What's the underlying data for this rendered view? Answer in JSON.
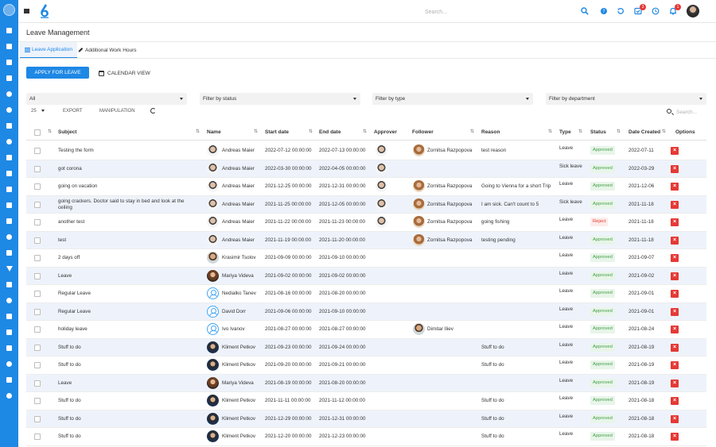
{
  "topbar": {
    "search_placeholder": "Search...",
    "tasks_badge": "3",
    "notifications_badge": "1"
  },
  "page": {
    "title": "Leave Management"
  },
  "tabs": [
    {
      "label": "Leave Application",
      "active": true
    },
    {
      "label": "Additional Work Hours",
      "active": false
    }
  ],
  "actions": {
    "apply_label": "APPLY FOR LEAVE",
    "calendar_label": "CALENDAR VIEW"
  },
  "filters": {
    "employee": "All",
    "status": "Filter by status",
    "type": "Filter by type",
    "department": "Filter by department"
  },
  "controls": {
    "page_size": "25",
    "export_label": "EXPORT",
    "manipulation_label": "MANIPULATION",
    "search_placeholder": "Search..."
  },
  "columns": {
    "subject": "Subject",
    "name": "Name",
    "start": "Start date",
    "end": "End date",
    "approver": "Approver",
    "follower": "Follower",
    "reason": "Reason",
    "type": "Type",
    "status": "Status",
    "created": "Date Created",
    "options": "Options"
  },
  "rows": [
    {
      "subject": "Testing the form",
      "name": "Andreas Maier",
      "avatar": "m1",
      "start": "2022-07-12 00:00:00",
      "end": "2022-07-13 00:00:00",
      "approver": true,
      "follower": "Zornitsa Razpopova",
      "follower_avatar": "f1",
      "reason": "test reason",
      "type": "Leave",
      "status": "Approved",
      "created": "2022-07-11"
    },
    {
      "subject": "got corona",
      "name": "Andreas Maier",
      "avatar": "m1",
      "start": "2022-03-30 00:00:00",
      "end": "2022-04-05 00:00:00",
      "approver": true,
      "follower": "",
      "follower_avatar": "",
      "reason": "",
      "type": "Sick leave",
      "status": "Approved",
      "created": "2022-03-29"
    },
    {
      "subject": "going on vacation",
      "name": "Andreas Maier",
      "avatar": "m1",
      "start": "2021-12-25 00:00:00",
      "end": "2021-12-31 00:00:00",
      "approver": true,
      "follower": "Zornitsa Razpopova",
      "follower_avatar": "f1",
      "reason": "Going to Vienna for a short Trip",
      "type": "Leave",
      "status": "Approved",
      "created": "2021-12-06"
    },
    {
      "subject": "going crackers. Doctor said to stay in bed and look at the ceiling",
      "name": "Andreas Maier",
      "avatar": "m1",
      "start": "2021-11-25 00:00:00",
      "end": "2021-12-05 00:00:00",
      "approver": true,
      "follower": "Zornitsa Razpopova",
      "follower_avatar": "f1",
      "reason": "I am sick. Can't count to 5",
      "type": "Sick leave",
      "status": "Approved",
      "created": "2021-11-18"
    },
    {
      "subject": "another test",
      "name": "Andreas Maier",
      "avatar": "m1",
      "start": "2021-11-22 00:00:00",
      "end": "2021-11-23 00:00:00",
      "approver": true,
      "follower": "Zornitsa Razpopova",
      "follower_avatar": "f1",
      "reason": "going fishing",
      "type": "Leave",
      "status": "Reject",
      "created": "2021-11-18"
    },
    {
      "subject": "test",
      "name": "Andreas Maier",
      "avatar": "m1",
      "start": "2021-11-19 00:00:00",
      "end": "2021-11-20 00:00:00",
      "approver": false,
      "follower": "Zornitsa Razpopova",
      "follower_avatar": "f1",
      "reason": "testing pending",
      "type": "Leave",
      "status": "Approved",
      "created": "2021-11-18"
    },
    {
      "subject": "2 days off",
      "name": "Krasimir Tsolov",
      "avatar": "m2",
      "start": "2021-09-09 00:00:00",
      "end": "2021-09-10 00:00:00",
      "approver": false,
      "follower": "",
      "follower_avatar": "",
      "reason": "",
      "type": "Leave",
      "status": "Approved",
      "created": "2021-09-07"
    },
    {
      "subject": "Leave",
      "name": "Mariya Videva",
      "avatar": "f2",
      "start": "2021-09-02 00:00:00",
      "end": "2021-09-02 00:00:00",
      "approver": false,
      "follower": "",
      "follower_avatar": "",
      "reason": "",
      "type": "Leave",
      "status": "Approved",
      "created": "2021-09-02"
    },
    {
      "subject": "Regular Leave",
      "name": "Nedialko Tanev",
      "avatar": "u1",
      "start": "2021-08-16 00:00:00",
      "end": "2021-08-20 00:00:00",
      "approver": false,
      "follower": "",
      "follower_avatar": "",
      "reason": "",
      "type": "Leave",
      "status": "Approved",
      "created": "2021-09-01"
    },
    {
      "subject": "Regular Leave",
      "name": "David Dorr",
      "avatar": "u1",
      "start": "2021-09-06 00:00:00",
      "end": "2021-09-10 00:00:00",
      "approver": false,
      "follower": "",
      "follower_avatar": "",
      "reason": "",
      "type": "Leave",
      "status": "Approved",
      "created": "2021-09-01"
    },
    {
      "subject": "holiday leave",
      "name": "Ivo Ivanov",
      "avatar": "u1",
      "start": "2021-08-27 00:00:00",
      "end": "2021-08-27 00:00:00",
      "approver": false,
      "follower": "Dimitar Iliev",
      "follower_avatar": "m2",
      "reason": "",
      "type": "Leave",
      "status": "Approved",
      "created": "2021-08-24"
    },
    {
      "subject": "Stuff to do",
      "name": "Kliment Petkov",
      "avatar": "m3",
      "start": "2021-09-23 00:00:00",
      "end": "2021-09-24 00:00:00",
      "approver": false,
      "follower": "",
      "follower_avatar": "",
      "reason": "Stuff to do",
      "type": "Leave",
      "status": "Approved",
      "created": "2021-08-19"
    },
    {
      "subject": "Stuff to do",
      "name": "Kliment Petkov",
      "avatar": "m3",
      "start": "2021-09-20 00:00:00",
      "end": "2021-09-21 00:00:00",
      "approver": false,
      "follower": "",
      "follower_avatar": "",
      "reason": "Stuff to do",
      "type": "Leave",
      "status": "Approved",
      "created": "2021-08-19"
    },
    {
      "subject": "Leave",
      "name": "Mariya Videva",
      "avatar": "f2",
      "start": "2021-08-19 00:00:00",
      "end": "2021-08-20 00:00:00",
      "approver": false,
      "follower": "",
      "follower_avatar": "",
      "reason": "",
      "type": "Leave",
      "status": "Approved",
      "created": "2021-08-19"
    },
    {
      "subject": "Stuff to do",
      "name": "Kliment Petkov",
      "avatar": "m3",
      "start": "2021-11-11 00:00:00",
      "end": "2021-11-12 00:00:00",
      "approver": false,
      "follower": "",
      "follower_avatar": "",
      "reason": "Stuff to do",
      "type": "Leave",
      "status": "Approved",
      "created": "2021-08-18"
    },
    {
      "subject": "Stuff to do",
      "name": "Kliment Petkov",
      "avatar": "m3",
      "start": "2021-12-29 00:00:00",
      "end": "2021-12-31 00:00:00",
      "approver": false,
      "follower": "",
      "follower_avatar": "",
      "reason": "Stuff to do",
      "type": "Leave",
      "status": "Approved",
      "created": "2021-08-18"
    },
    {
      "subject": "Stuff to do",
      "name": "Kliment Petkov",
      "avatar": "m3",
      "start": "2021-12-20 00:00:00",
      "end": "2021-12-23 00:00:00",
      "approver": false,
      "follower": "",
      "follower_avatar": "",
      "reason": "Stuff to do",
      "type": "Leave",
      "status": "Approved",
      "created": "2021-08-18"
    }
  ]
}
